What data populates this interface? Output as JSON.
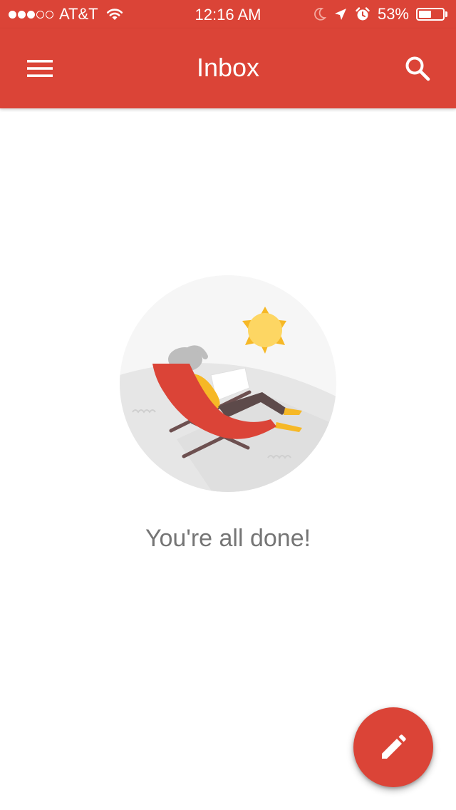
{
  "status_bar": {
    "carrier": "AT&T",
    "time": "12:16 AM",
    "battery_percent": "53%",
    "battery_level": 0.53,
    "signal_strength_bars": 3,
    "signal_total_bars": 5,
    "icons": [
      "wifi-icon",
      "moon-icon",
      "location-arrow-icon",
      "alarm-icon",
      "battery-icon"
    ]
  },
  "app_bar": {
    "title": "Inbox",
    "menu_icon": "hamburger-menu-icon",
    "search_icon": "search-icon",
    "color": "#db4437"
  },
  "main": {
    "message": "You're all done!",
    "illustration": "beach-chair-relaxing-illustration"
  },
  "fab": {
    "icon": "pencil-icon",
    "color": "#db4437"
  },
  "colors": {
    "accent": "#db4437",
    "message_text": "#757575",
    "sun": "#fdd663",
    "chair": "#db4437"
  }
}
